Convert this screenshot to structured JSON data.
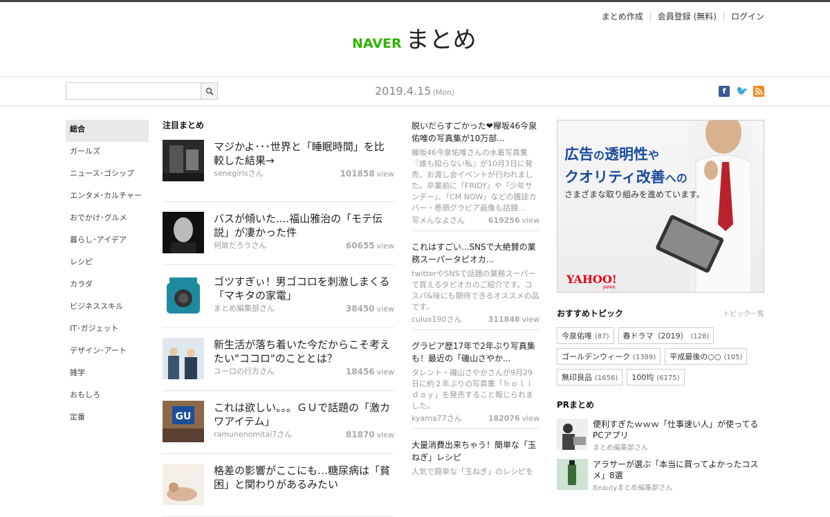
{
  "header": {
    "nav": [
      "まとめ作成",
      "会員登録 (無料)",
      "ログイン"
    ],
    "logo_naver": "NAVER",
    "logo_matome": "まとめ"
  },
  "subbar": {
    "date": "2019.4.15",
    "weekday": "(Mon)",
    "search_placeholder": ""
  },
  "sidebar": {
    "items": [
      "総合",
      "ガールズ",
      "ニュース･ゴシップ",
      "エンタメ･カルチャー",
      "おでかけ･グルメ",
      "暮らし･アイデア",
      "レシピ",
      "カラダ",
      "ビジネススキル",
      "IT･ガジェット",
      "デザイン･アート",
      "雑学",
      "おもしろ",
      "定番"
    ]
  },
  "featured": {
    "title": "注目まとめ",
    "view_label": "view",
    "cards": [
      {
        "title": "マジかよ･･･世界と「睡眠時間」を比較した結果→",
        "author": "senegirlsさん",
        "views": "101858"
      },
      {
        "title": "バスが傾いた....福山雅治の「モテ伝説」が凄かった件",
        "author": "何故だろうさん",
        "views": "60655"
      },
      {
        "title": "ゴツすぎぃ！男ゴコロを刺激しまくる「マキタの家電」",
        "author": "まとめ編集部さん",
        "views": "38450"
      },
      {
        "title": "新生活が落ち着いた今だからこそ考えたい\"ココロ\"のこととは？",
        "author": "ユーロの行方さん",
        "views": "18456"
      },
      {
        "title": "これは欲しい。。。ＧＵで話題の「激カワアイテム」",
        "author": "ramunenomitai7さん",
        "views": "81870"
      },
      {
        "title": "格差の影響がここにも…糖尿病は「貧困」と関わりがあるみたい",
        "author": "",
        "views": ""
      }
    ]
  },
  "articles": [
    {
      "title": "脱いだらすごかった❤欅坂46今泉佑唯の写真集が10万部...",
      "desc": "欅坂46今泉佑唯さんの水着写真集『誰も知らない私』が10月3日に発売、お渡し会イベントが行われました。卒業前に「FRIDY」や「少年サンデー」、「CM NOW」などの雑誌カバー・巻頭グラビア画像も話題...",
      "author": "写メんなよさん",
      "views": "619256"
    },
    {
      "title": "これはすごい...SNSで大絶賛の業務スーパータピオカ...",
      "desc": "twitterやSNSで話題の業務スーパーで買えるタピオカのご紹介です。コスパ&味にも期待できるオススメの品です。",
      "author": "culux190さん",
      "views": "311848"
    },
    {
      "title": "グラビア歴17年で2年ぶり写真集も！最近の「磯山さやか...",
      "desc": "タレント・磯山さやかさんが9月29日に約２年ぶりの写真集「ｈｏｌｉｄａｙ」を発売すること報じられました。",
      "author": "kyama77さん",
      "views": "182076"
    },
    {
      "title": "大量消費出来ちゃう！簡単な「玉ねぎ」レシピ",
      "desc": "人気で簡単な「玉ねぎ」のレシピを",
      "author": "",
      "views": ""
    }
  ],
  "ad": {
    "line1_a": "広告",
    "line1_b": "の",
    "line1_c": "透明性",
    "line1_d": "や",
    "line2_a": "クオリティ改善",
    "line2_b": "への",
    "line3": "さまざまな取り組みを進めています。",
    "brand": "YAHOO!",
    "brand_sub": "JAPAN"
  },
  "topics": {
    "title": "おすすめトピック",
    "more": "トピック一覧",
    "tags": [
      {
        "label": "今泉佑唯",
        "count": "(87)"
      },
      {
        "label": "春ドラマ（2019）",
        "count": "(128)"
      },
      {
        "label": "ゴールデンウィーク",
        "count": "(1389)"
      },
      {
        "label": "平成最後の○○",
        "count": "(105)"
      },
      {
        "label": "無印良品",
        "count": "(1656)"
      },
      {
        "label": "100均",
        "count": "(6175)"
      }
    ]
  },
  "pr": {
    "title": "PRまとめ",
    "items": [
      {
        "title": "便利すぎたｗｗｗ「仕事速い人」が使ってるPCアプリ",
        "author": "まとめ編集部さん"
      },
      {
        "title": "アラサーが選ぶ「本当に買ってよかったコスメ」8選",
        "author": "Beautyまとめ編集部さん"
      }
    ]
  },
  "colors": {
    "brand_green": "#2db400",
    "ad_blue": "#1a4b9a",
    "yahoo_red": "#e60012"
  }
}
